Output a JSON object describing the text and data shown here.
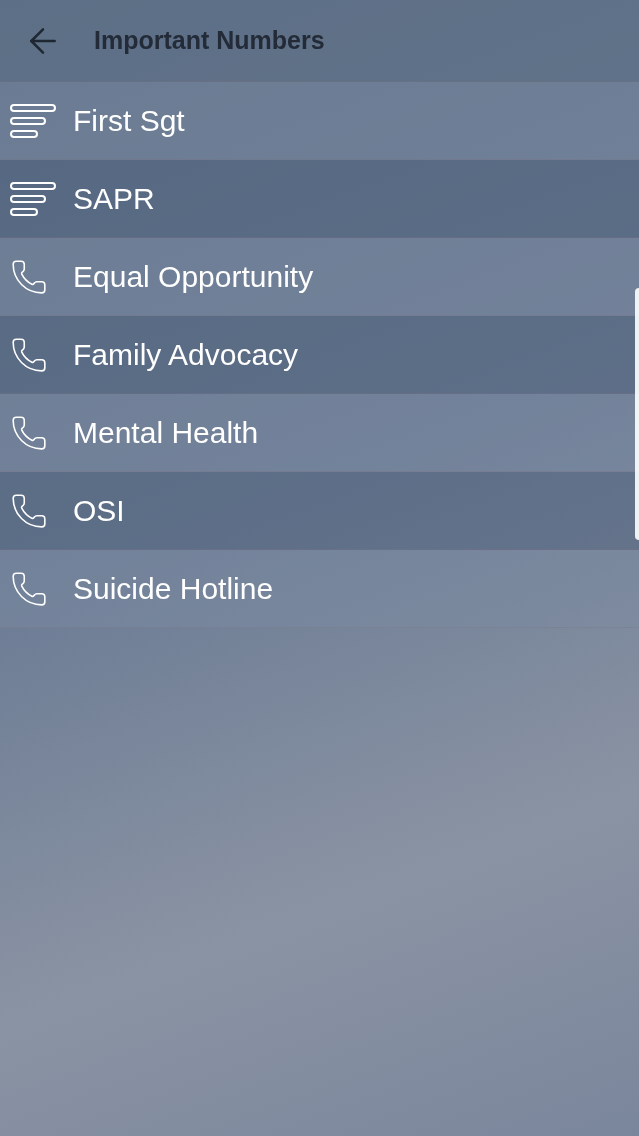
{
  "header": {
    "title": "Important Numbers"
  },
  "items": [
    {
      "label": "First Sgt",
      "kind": "group"
    },
    {
      "label": "SAPR",
      "kind": "group"
    },
    {
      "label": "Equal Opportunity",
      "kind": "phone"
    },
    {
      "label": "Family Advocacy",
      "kind": "phone"
    },
    {
      "label": "Mental Health",
      "kind": "phone"
    },
    {
      "label": "OSI",
      "kind": "phone"
    },
    {
      "label": "Suicide Hotline",
      "kind": "phone"
    }
  ]
}
